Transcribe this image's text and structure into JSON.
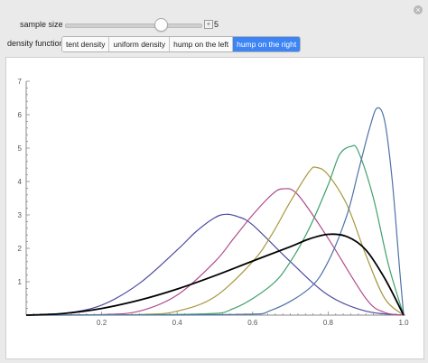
{
  "controls": {
    "sample_size_label": "sample size",
    "sample_size_value": "5",
    "sample_size_min": 1,
    "sample_size_max": 6,
    "density_label": "density function",
    "density_options": [
      "tent density",
      "uniform density",
      "hump on the left",
      "hump on the right"
    ],
    "density_selected": "hump on the right"
  },
  "chart_data": {
    "type": "line",
    "title": "",
    "xlabel": "",
    "ylabel": "",
    "xlim": [
      0,
      1
    ],
    "ylim": [
      0,
      7
    ],
    "x_ticks": [
      "0.2",
      "0.4",
      "0.6",
      "0.8",
      "1.0"
    ],
    "y_ticks": [
      "1",
      "2",
      "3",
      "4",
      "5",
      "6",
      "7"
    ],
    "grid": false,
    "series": [
      {
        "color": "#4b4ba0",
        "points": [
          [
            0,
            0
          ],
          [
            0.1,
            0.05
          ],
          [
            0.2,
            0.3
          ],
          [
            0.3,
            0.95
          ],
          [
            0.4,
            1.95
          ],
          [
            0.45,
            2.5
          ],
          [
            0.5,
            2.92
          ],
          [
            0.53,
            3.02
          ],
          [
            0.56,
            2.95
          ],
          [
            0.6,
            2.7
          ],
          [
            0.7,
            1.6
          ],
          [
            0.8,
            0.6
          ],
          [
            0.9,
            0.12
          ],
          [
            1,
            0
          ]
        ]
      },
      {
        "color": "#b04c8e",
        "points": [
          [
            0,
            0
          ],
          [
            0.2,
            0.02
          ],
          [
            0.3,
            0.12
          ],
          [
            0.4,
            0.6
          ],
          [
            0.5,
            1.6
          ],
          [
            0.55,
            2.3
          ],
          [
            0.6,
            3.0
          ],
          [
            0.65,
            3.6
          ],
          [
            0.68,
            3.78
          ],
          [
            0.72,
            3.6
          ],
          [
            0.8,
            2.3
          ],
          [
            0.9,
            0.5
          ],
          [
            0.95,
            0.08
          ],
          [
            1,
            0
          ]
        ]
      },
      {
        "color": "#a8983e",
        "points": [
          [
            0,
            0
          ],
          [
            0.3,
            0.02
          ],
          [
            0.4,
            0.12
          ],
          [
            0.5,
            0.55
          ],
          [
            0.6,
            1.6
          ],
          [
            0.65,
            2.4
          ],
          [
            0.7,
            3.4
          ],
          [
            0.75,
            4.3
          ],
          [
            0.77,
            4.42
          ],
          [
            0.8,
            4.2
          ],
          [
            0.85,
            3.3
          ],
          [
            0.9,
            1.8
          ],
          [
            0.95,
            0.5
          ],
          [
            1,
            0
          ]
        ]
      },
      {
        "color": "#3fa06a",
        "points": [
          [
            0,
            0
          ],
          [
            0.45,
            0.03
          ],
          [
            0.55,
            0.2
          ],
          [
            0.65,
            0.9
          ],
          [
            0.7,
            1.6
          ],
          [
            0.75,
            2.6
          ],
          [
            0.8,
            3.9
          ],
          [
            0.83,
            4.8
          ],
          [
            0.86,
            5.05
          ],
          [
            0.88,
            4.9
          ],
          [
            0.92,
            3.5
          ],
          [
            0.96,
            1.5
          ],
          [
            1,
            0
          ]
        ]
      },
      {
        "color": "#4f72a8",
        "points": [
          [
            0,
            0
          ],
          [
            0.55,
            0.02
          ],
          [
            0.65,
            0.15
          ],
          [
            0.75,
            0.8
          ],
          [
            0.8,
            1.6
          ],
          [
            0.85,
            3.0
          ],
          [
            0.88,
            4.3
          ],
          [
            0.91,
            5.6
          ],
          [
            0.93,
            6.2
          ],
          [
            0.95,
            5.8
          ],
          [
            0.97,
            4.0
          ],
          [
            0.99,
            1.3
          ],
          [
            1,
            0
          ]
        ]
      },
      {
        "color": "#000000",
        "points": [
          [
            0,
            0
          ],
          [
            0.1,
            0.05
          ],
          [
            0.2,
            0.2
          ],
          [
            0.3,
            0.45
          ],
          [
            0.4,
            0.78
          ],
          [
            0.5,
            1.18
          ],
          [
            0.6,
            1.62
          ],
          [
            0.7,
            2.05
          ],
          [
            0.75,
            2.28
          ],
          [
            0.8,
            2.42
          ],
          [
            0.85,
            2.35
          ],
          [
            0.9,
            1.95
          ],
          [
            0.95,
            1.1
          ],
          [
            1,
            0
          ]
        ]
      }
    ]
  }
}
